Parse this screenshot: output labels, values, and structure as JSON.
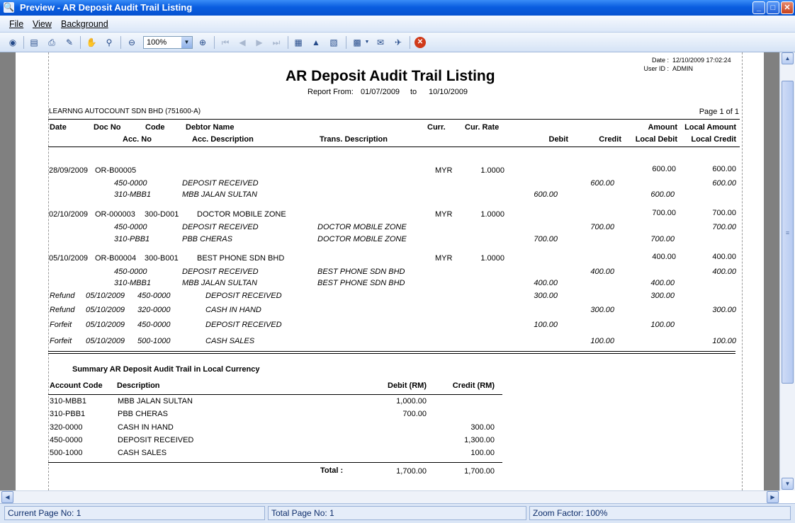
{
  "window": {
    "title": "Preview - AR Deposit Audit Trail Listing"
  },
  "menu": {
    "file": "File",
    "view": "View",
    "background": "Background"
  },
  "toolbar": {
    "zoom": "100%"
  },
  "report": {
    "date_label": "Date :",
    "date_value": "12/10/2009 17:02:24",
    "user_label": "User ID :",
    "user_value": "ADMIN",
    "title": "AR Deposit Audit Trail Listing",
    "range_label": "Report From:",
    "from": "01/07/2009",
    "to_label": "to",
    "to": "10/10/2009",
    "company": "LEARNNG AUTOCOUNT SDN BHD (751600-A)",
    "page": "Page 1 of 1",
    "headers": {
      "date": "Date",
      "doc_no": "Doc No",
      "code": "Code",
      "debtor": "Debtor Name",
      "curr": "Curr.",
      "rate": "Cur. Rate",
      "amount": "Amount",
      "local_amount": "Local Amount",
      "acc_no": "Acc. No",
      "acc_desc": "Acc. Description",
      "trans_desc": "Trans. Description",
      "debit": "Debit",
      "credit": "Credit",
      "local_debit": "Local Debit",
      "local_credit": "Local Credit"
    },
    "docs": [
      {
        "date": "28/09/2009",
        "doc": "OR-B00005",
        "code": "",
        "debtor": "",
        "curr": "MYR",
        "rate": "1.0000",
        "amount": "600.00",
        "local": "600.00",
        "lines": [
          {
            "acc": "450-0000",
            "desc": "DEPOSIT RECEIVED",
            "trans": "",
            "debit": "",
            "credit": "600.00",
            "ldebit": "",
            "lcredit": "600.00"
          },
          {
            "acc": "310-MBB1",
            "desc": "MBB JALAN SULTAN",
            "trans": "",
            "debit": "600.00",
            "credit": "",
            "ldebit": "600.00",
            "lcredit": ""
          }
        ]
      },
      {
        "date": "02/10/2009",
        "doc": "OR-000003",
        "code": "300-D001",
        "debtor": "DOCTOR MOBILE ZONE",
        "curr": "MYR",
        "rate": "1.0000",
        "amount": "700.00",
        "local": "700.00",
        "lines": [
          {
            "acc": "450-0000",
            "desc": "DEPOSIT RECEIVED",
            "trans": "DOCTOR MOBILE ZONE",
            "debit": "",
            "credit": "700.00",
            "ldebit": "",
            "lcredit": "700.00"
          },
          {
            "acc": "310-PBB1",
            "desc": "PBB CHERAS",
            "trans": "DOCTOR MOBILE ZONE",
            "debit": "700.00",
            "credit": "",
            "ldebit": "700.00",
            "lcredit": ""
          }
        ]
      },
      {
        "date": "05/10/2009",
        "doc": "OR-B00004",
        "code": "300-B001",
        "debtor": "BEST PHONE SDN BHD",
        "curr": "MYR",
        "rate": "1.0000",
        "amount": "400.00",
        "local": "400.00",
        "lines": [
          {
            "acc": "450-0000",
            "desc": "DEPOSIT RECEIVED",
            "trans": "BEST PHONE SDN BHD",
            "debit": "",
            "credit": "400.00",
            "ldebit": "",
            "lcredit": "400.00"
          },
          {
            "acc": "310-MBB1",
            "desc": "MBB JALAN SULTAN",
            "trans": "BEST PHONE SDN BHD",
            "debit": "400.00",
            "credit": "",
            "ldebit": "400.00",
            "lcredit": ""
          }
        ]
      }
    ],
    "adjustments": [
      {
        "type": "Refund",
        "date": "05/10/2009",
        "acc": "450-0000",
        "desc": "DEPOSIT RECEIVED",
        "debit": "300.00",
        "credit": "",
        "ldebit": "300.00",
        "lcredit": ""
      },
      {
        "type": "Refund",
        "date": "05/10/2009",
        "acc": "320-0000",
        "desc": "CASH IN HAND",
        "debit": "",
        "credit": "300.00",
        "ldebit": "",
        "lcredit": "300.00"
      },
      {
        "type": "Forfeit",
        "date": "05/10/2009",
        "acc": "450-0000",
        "desc": "DEPOSIT RECEIVED",
        "debit": "100.00",
        "credit": "",
        "ldebit": "100.00",
        "lcredit": ""
      },
      {
        "type": "Forfeit",
        "date": "05/10/2009",
        "acc": "500-1000",
        "desc": "CASH SALES",
        "debit": "",
        "credit": "100.00",
        "ldebit": "",
        "lcredit": "100.00"
      }
    ],
    "summary": {
      "title": "Summary AR Deposit Audit Trail in Local Currency",
      "headers": {
        "acc": "Account Code",
        "desc": "Description",
        "debit": "Debit (RM)",
        "credit": "Credit (RM)"
      },
      "rows": [
        {
          "acc": "310-MBB1",
          "desc": "MBB JALAN SULTAN",
          "debit": "1,000.00",
          "credit": ""
        },
        {
          "acc": "310-PBB1",
          "desc": "PBB CHERAS",
          "debit": "700.00",
          "credit": ""
        },
        {
          "acc": "320-0000",
          "desc": "CASH IN HAND",
          "debit": "",
          "credit": "300.00"
        },
        {
          "acc": "450-0000",
          "desc": "DEPOSIT RECEIVED",
          "debit": "",
          "credit": "1,300.00"
        },
        {
          "acc": "500-1000",
          "desc": "CASH SALES",
          "debit": "",
          "credit": "100.00"
        }
      ],
      "total_label": "Total :",
      "total_debit": "1,700.00",
      "total_credit": "1,700.00"
    }
  },
  "status": {
    "current_page": "Current Page No: 1",
    "total_page": "Total Page No: 1",
    "zoom": "Zoom Factor: 100%"
  }
}
